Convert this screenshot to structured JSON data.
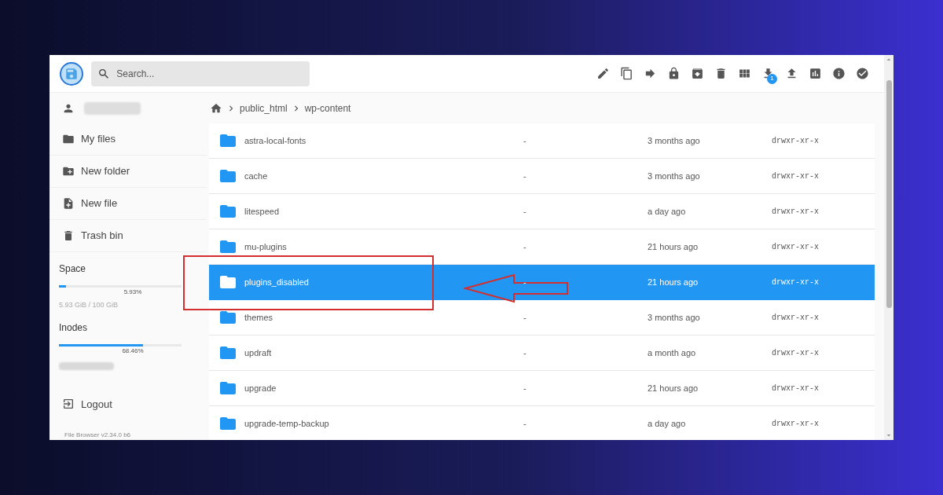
{
  "search": {
    "placeholder": "Search..."
  },
  "toolbar": {
    "download_badge": "1"
  },
  "breadcrumb": [
    "public_html",
    "wp-content"
  ],
  "sidebar": {
    "items": [
      {
        "kind": "files",
        "label": "My files"
      },
      {
        "kind": "new-folder",
        "label": "New folder"
      },
      {
        "kind": "new-file",
        "label": "New file"
      },
      {
        "kind": "trash",
        "label": "Trash bin"
      }
    ],
    "space": {
      "title": "Space",
      "level": 0.0593,
      "reading": "5.93%",
      "detail": "5.93 GiB / 100 GiB"
    },
    "inodes": {
      "title": "Inodes",
      "level": 0.6846,
      "reading": "68.46%"
    },
    "logout": "Logout",
    "version": "File Browser v2.34.0 b6"
  },
  "files": [
    {
      "name": "astra-local-fonts",
      "size": "-",
      "modified": "3 months ago",
      "permissions": "drwxr-xr-x",
      "selected": false
    },
    {
      "name": "cache",
      "size": "-",
      "modified": "3 months ago",
      "permissions": "drwxr-xr-x",
      "selected": false
    },
    {
      "name": "litespeed",
      "size": "-",
      "modified": "a day ago",
      "permissions": "drwxr-xr-x",
      "selected": false
    },
    {
      "name": "mu-plugins",
      "size": "-",
      "modified": "21 hours ago",
      "permissions": "drwxr-xr-x",
      "selected": false
    },
    {
      "name": "plugins_disabled",
      "size": "-",
      "modified": "21 hours ago",
      "permissions": "drwxr-xr-x",
      "selected": true
    },
    {
      "name": "themes",
      "size": "-",
      "modified": "3 months ago",
      "permissions": "drwxr-xr-x",
      "selected": false
    },
    {
      "name": "updraft",
      "size": "-",
      "modified": "a month ago",
      "permissions": "drwxr-xr-x",
      "selected": false
    },
    {
      "name": "upgrade",
      "size": "-",
      "modified": "21 hours ago",
      "permissions": "drwxr-xr-x",
      "selected": false
    },
    {
      "name": "upgrade-temp-backup",
      "size": "-",
      "modified": "a day ago",
      "permissions": "drwxr-xr-x",
      "selected": false
    }
  ]
}
